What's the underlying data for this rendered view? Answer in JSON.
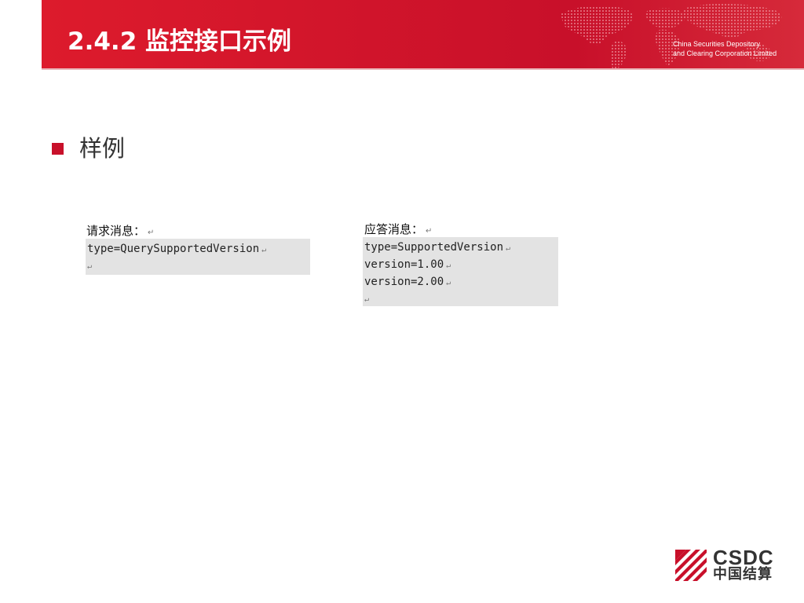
{
  "header": {
    "title": "2.4.2 监控接口示例",
    "company_line1": "China Securities Depository",
    "company_line2": "and Clearing Corporation Limited",
    "background_color": "#c8102a",
    "map_icon": "world-map-icon"
  },
  "bullet": {
    "text": "样例",
    "color": "#c8102a",
    "icon": "square-bullet-icon"
  },
  "request": {
    "label": "请求消息：",
    "lines": [
      "type=QuerySupportedVersion"
    ]
  },
  "response": {
    "label": "应答消息：",
    "lines": [
      "type=SupportedVersion",
      "version=1.00",
      "version=2.00"
    ]
  },
  "paragraph_mark": "↵",
  "logo": {
    "en": "CSDC",
    "cn": "中国结算",
    "icon": "csdc-stripes-icon",
    "accent": "#c8102a"
  }
}
